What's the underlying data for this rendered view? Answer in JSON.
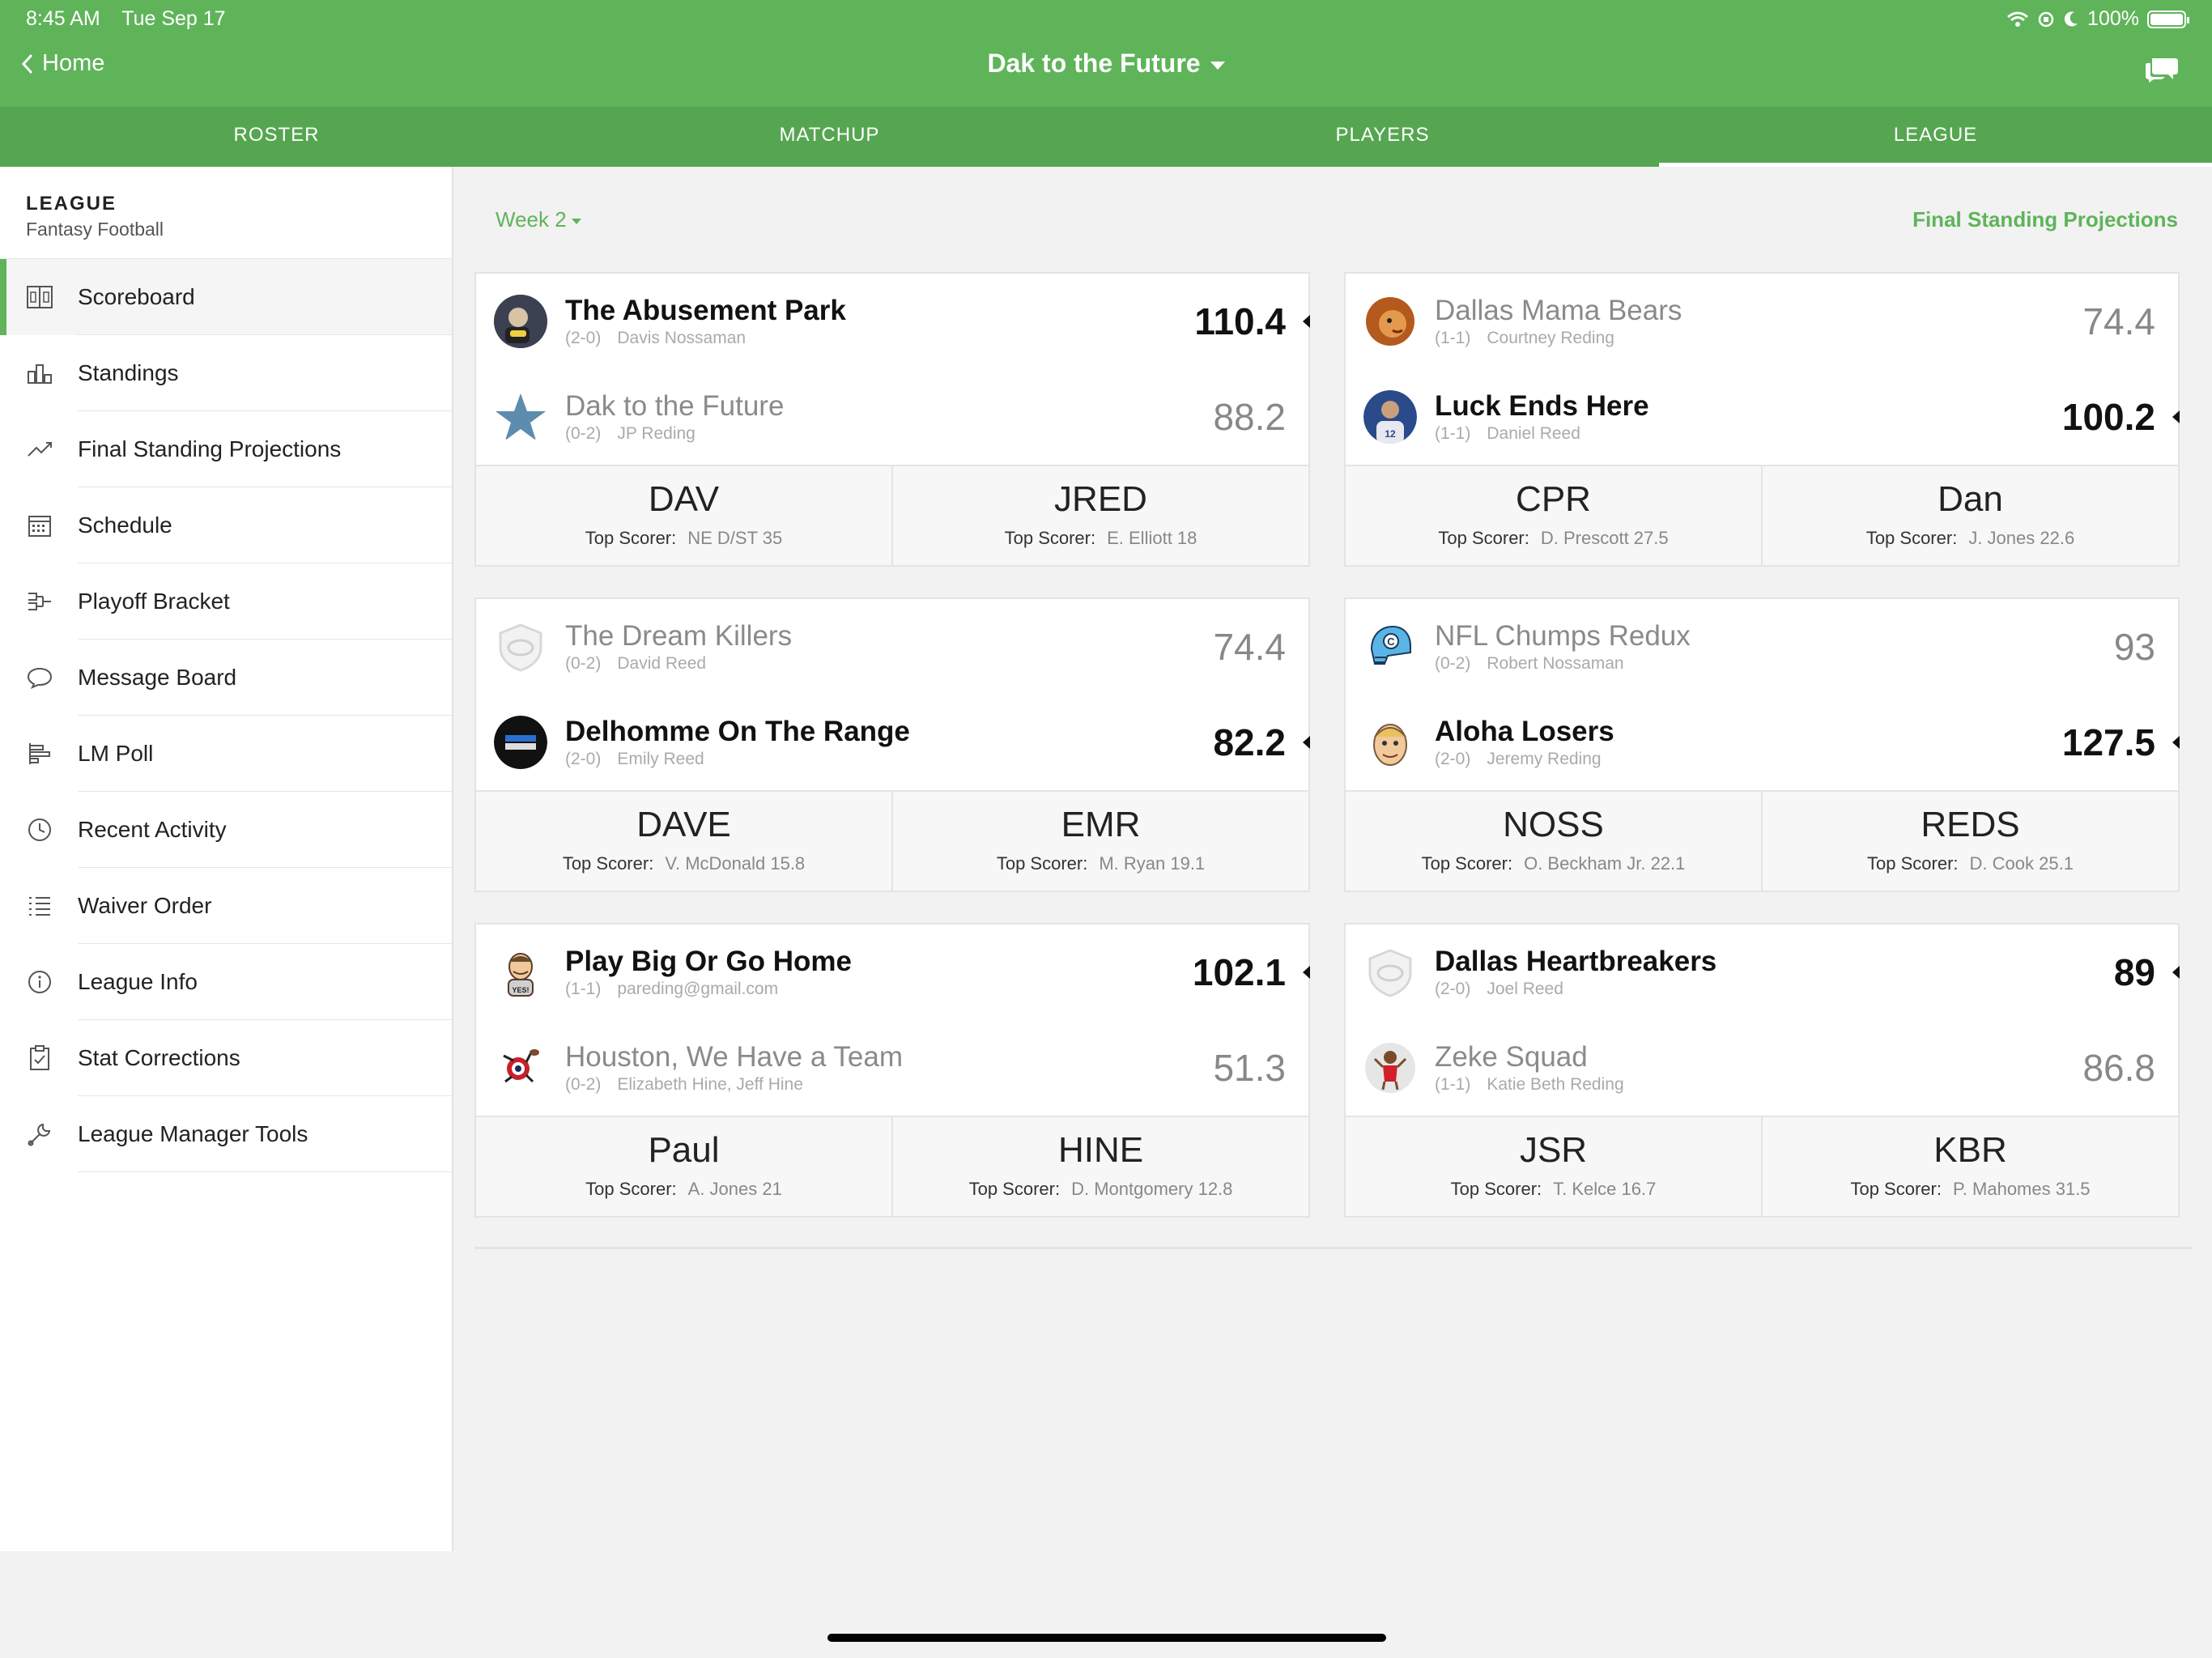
{
  "status": {
    "time": "8:45 AM",
    "date": "Tue Sep 17",
    "battery": "100%"
  },
  "header": {
    "back_label": "Home",
    "title": "Dak to the Future"
  },
  "tabs": [
    {
      "label": "ROSTER"
    },
    {
      "label": "MATCHUP"
    },
    {
      "label": "PLAYERS"
    },
    {
      "label": "LEAGUE"
    }
  ],
  "sidebar": {
    "title": "LEAGUE",
    "subtitle": "Fantasy Football",
    "items": [
      {
        "label": "Scoreboard",
        "icon": "scoreboard-icon"
      },
      {
        "label": "Standings",
        "icon": "standings-icon"
      },
      {
        "label": "Final Standing Projections",
        "icon": "trend-icon"
      },
      {
        "label": "Schedule",
        "icon": "calendar-icon"
      },
      {
        "label": "Playoff Bracket",
        "icon": "bracket-icon"
      },
      {
        "label": "Message Board",
        "icon": "speech-bubble-icon"
      },
      {
        "label": "LM Poll",
        "icon": "poll-icon"
      },
      {
        "label": "Recent Activity",
        "icon": "clock-icon"
      },
      {
        "label": "Waiver Order",
        "icon": "list-icon"
      },
      {
        "label": "League Info",
        "icon": "info-icon"
      },
      {
        "label": "Stat Corrections",
        "icon": "clipboard-icon"
      },
      {
        "label": "League Manager Tools",
        "icon": "wrench-icon"
      }
    ]
  },
  "main": {
    "week_label": "Week 2",
    "projections_link": "Final Standing Projections",
    "top_scorer_label": "Top Scorer:",
    "matchups": [
      {
        "teams": [
          {
            "name": "The Abusement Park",
            "record": "(2-0)",
            "owner": "Davis Nossaman",
            "score": "110.4",
            "winner": true,
            "avatar": "gamer-avatar"
          },
          {
            "name": "Dak to the Future",
            "record": "(0-2)",
            "owner": "JP Reding",
            "score": "88.2",
            "winner": false,
            "avatar": "star-avatar"
          }
        ],
        "abbrs": [
          {
            "abbr": "DAV",
            "top": "NE D/ST 35"
          },
          {
            "abbr": "JRED",
            "top": "E. Elliott 18"
          }
        ]
      },
      {
        "teams": [
          {
            "name": "Dallas Mama Bears",
            "record": "(1-1)",
            "owner": "Courtney Reding",
            "score": "74.4",
            "winner": false,
            "avatar": "lion-avatar"
          },
          {
            "name": "Luck Ends Here",
            "record": "(1-1)",
            "owner": "Daniel Reed",
            "score": "100.2",
            "winner": true,
            "avatar": "player-avatar"
          }
        ],
        "abbrs": [
          {
            "abbr": "CPR",
            "top": "D. Prescott 27.5"
          },
          {
            "abbr": "Dan",
            "top": "J. Jones 22.6"
          }
        ]
      },
      {
        "teams": [
          {
            "name": "The Dream Killers",
            "record": "(0-2)",
            "owner": "David Reed",
            "score": "74.4",
            "winner": false,
            "avatar": "default-shield-avatar"
          },
          {
            "name": "Delhomme On The Range",
            "record": "(2-0)",
            "owner": "Emily Reed",
            "score": "82.2",
            "winner": true,
            "avatar": "black-logo-avatar"
          }
        ],
        "abbrs": [
          {
            "abbr": "DAVE",
            "top": "V. McDonald 15.8"
          },
          {
            "abbr": "EMR",
            "top": "M. Ryan 19.1"
          }
        ]
      },
      {
        "teams": [
          {
            "name": "NFL Chumps Redux",
            "record": "(0-2)",
            "owner": "Robert Nossaman",
            "score": "93",
            "winner": false,
            "avatar": "helmet-avatar"
          },
          {
            "name": "Aloha Losers",
            "record": "(2-0)",
            "owner": "Jeremy Reding",
            "score": "127.5",
            "winner": true,
            "avatar": "cartoon-face-avatar"
          }
        ],
        "abbrs": [
          {
            "abbr": "NOSS",
            "top": "O. Beckham Jr. 22.1"
          },
          {
            "abbr": "REDS",
            "top": "D. Cook 25.1"
          }
        ]
      },
      {
        "teams": [
          {
            "name": "Play Big Or Go Home",
            "record": "(1-1)",
            "owner": "pareding@gmail.com",
            "score": "102.1",
            "winner": true,
            "avatar": "cartoon-man-avatar"
          },
          {
            "name": "Houston, We Have a Team",
            "record": "(0-2)",
            "owner": "Elizabeth Hine, Jeff Hine",
            "score": "51.3",
            "winner": false,
            "avatar": "mascot-avatar"
          }
        ],
        "abbrs": [
          {
            "abbr": "Paul",
            "top": "A. Jones 21"
          },
          {
            "abbr": "HINE",
            "top": "D. Montgomery 12.8"
          }
        ]
      },
      {
        "teams": [
          {
            "name": "Dallas Heartbreakers",
            "record": "(2-0)",
            "owner": "Joel Reed",
            "score": "89",
            "winner": true,
            "avatar": "default-shield-avatar"
          },
          {
            "name": "Zeke Squad",
            "record": "(1-1)",
            "owner": "Katie Beth Reding",
            "score": "86.8",
            "winner": false,
            "avatar": "cheerleader-avatar"
          }
        ],
        "abbrs": [
          {
            "abbr": "JSR",
            "top": "T. Kelce 16.7"
          },
          {
            "abbr": "KBR",
            "top": "P. Mahomes 31.5"
          }
        ]
      }
    ]
  },
  "colors": {
    "brand_green": "#5fb45a",
    "tab_green": "#56a651"
  }
}
